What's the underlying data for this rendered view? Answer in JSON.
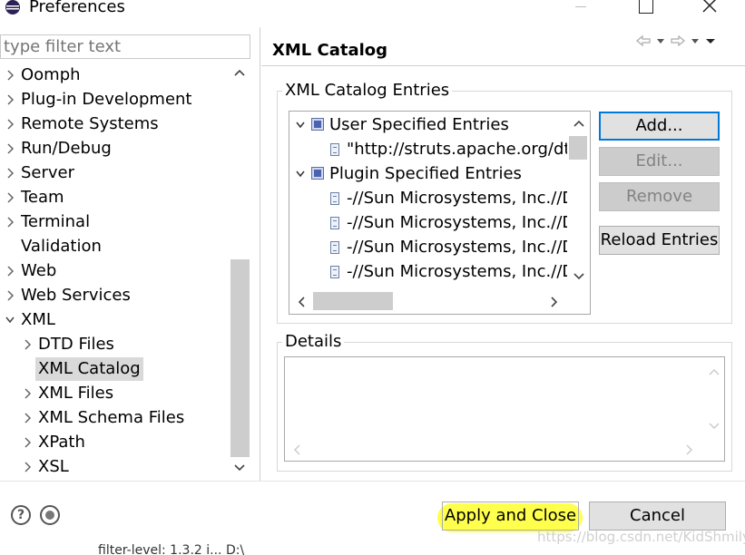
{
  "window": {
    "title": "Preferences"
  },
  "filter": {
    "placeholder": "type filter text"
  },
  "tree": {
    "items": [
      {
        "label": "Oomph",
        "expandable": true,
        "expanded": false,
        "level": 0
      },
      {
        "label": "Plug-in Development",
        "expandable": true,
        "expanded": false,
        "level": 0
      },
      {
        "label": "Remote Systems",
        "expandable": true,
        "expanded": false,
        "level": 0
      },
      {
        "label": "Run/Debug",
        "expandable": true,
        "expanded": false,
        "level": 0
      },
      {
        "label": "Server",
        "expandable": true,
        "expanded": false,
        "level": 0
      },
      {
        "label": "Team",
        "expandable": true,
        "expanded": false,
        "level": 0
      },
      {
        "label": "Terminal",
        "expandable": true,
        "expanded": false,
        "level": 0
      },
      {
        "label": "Validation",
        "expandable": false,
        "expanded": false,
        "level": 0
      },
      {
        "label": "Web",
        "expandable": true,
        "expanded": false,
        "level": 0
      },
      {
        "label": "Web Services",
        "expandable": true,
        "expanded": false,
        "level": 0
      },
      {
        "label": "XML",
        "expandable": true,
        "expanded": true,
        "level": 0
      },
      {
        "label": "DTD Files",
        "expandable": true,
        "expanded": false,
        "level": 1
      },
      {
        "label": "XML Catalog",
        "expandable": false,
        "expanded": false,
        "level": 1,
        "selected": true
      },
      {
        "label": "XML Files",
        "expandable": true,
        "expanded": false,
        "level": 1
      },
      {
        "label": "XML Schema Files",
        "expandable": true,
        "expanded": false,
        "level": 1
      },
      {
        "label": "XPath",
        "expandable": true,
        "expanded": false,
        "level": 1
      },
      {
        "label": "XSL",
        "expandable": true,
        "expanded": false,
        "level": 1
      }
    ]
  },
  "page": {
    "title": "XML Catalog"
  },
  "catalog": {
    "group_label": "XML Catalog Entries",
    "entries": [
      {
        "label": "User Specified Entries",
        "type": "category",
        "level": 0
      },
      {
        "label": "\"http://struts.apache.org/dt",
        "type": "entry",
        "level": 1
      },
      {
        "label": "Plugin Specified Entries",
        "type": "category",
        "level": 0
      },
      {
        "label": "-//Sun Microsystems, Inc.//D",
        "type": "entry",
        "level": 1
      },
      {
        "label": "-//Sun Microsystems, Inc.//D",
        "type": "entry",
        "level": 1
      },
      {
        "label": "-//Sun Microsystems, Inc.//D",
        "type": "entry",
        "level": 1
      },
      {
        "label": "-//Sun Microsystems, Inc.//D",
        "type": "entry",
        "level": 1
      }
    ],
    "buttons": {
      "add": "Add...",
      "edit": "Edit...",
      "remove": "Remove",
      "reload": "Reload Entries"
    }
  },
  "details": {
    "group_label": "Details"
  },
  "footer": {
    "apply_close": "Apply and Close",
    "cancel": "Cancel",
    "help_glyph": "?"
  },
  "watermark": "https://blog.csdn.net/KidShmily",
  "below_text": "filter-level: 1.3.2 i... D:\\"
}
